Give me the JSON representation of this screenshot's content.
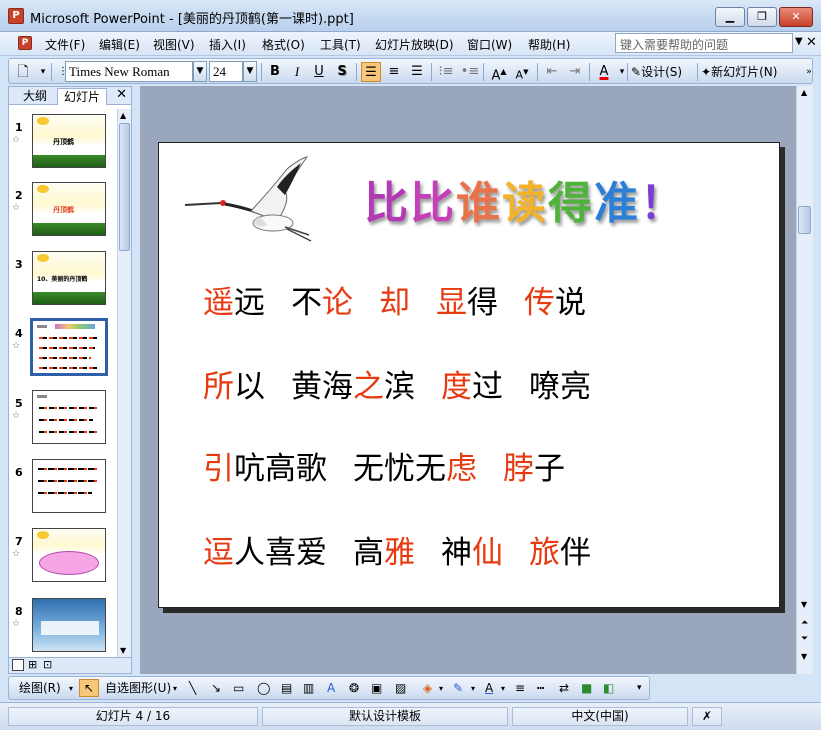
{
  "window": {
    "title": "Microsoft PowerPoint - [美丽的丹顶鹤(第一课时).ppt]",
    "minimize_glyph": "▁",
    "restore_glyph": "❐",
    "close_glyph": "✕"
  },
  "menu": {
    "items": [
      "文件(F)",
      "编辑(E)",
      "视图(V)",
      "插入(I)",
      "格式(O)",
      "工具(T)",
      "幻灯片放映(D)",
      "窗口(W)",
      "帮助(H)"
    ],
    "help_placeholder": "键入需要帮助的问题"
  },
  "toolbar": {
    "font_name": "Times New Roman",
    "font_size": "24",
    "bold": "B",
    "italic": "I",
    "underline": "U",
    "shadow": "S",
    "design_label": "设计(S)",
    "new_slide_label": "新幻灯片(N)"
  },
  "left_pane": {
    "tab_outline": "大纲",
    "tab_slides": "幻灯片",
    "close_glyph": "✕",
    "slides": [
      {
        "num": "1",
        "star": "☆",
        "label": "丹顶鹤"
      },
      {
        "num": "2",
        "star": "☆",
        "label": "丹顶鹤"
      },
      {
        "num": "3",
        "star": "",
        "label": "10、美丽的丹顶鹤"
      },
      {
        "num": "4",
        "star": "☆",
        "label": ""
      },
      {
        "num": "5",
        "star": "☆",
        "label": ""
      },
      {
        "num": "6",
        "star": "",
        "label": ""
      },
      {
        "num": "7",
        "star": "☆",
        "label": ""
      },
      {
        "num": "8",
        "star": "☆",
        "label": ""
      }
    ]
  },
  "slide": {
    "title_chars": [
      "比",
      "比",
      "谁",
      "读",
      "得",
      "准",
      "！"
    ],
    "title_colors": [
      "#b43ab5",
      "#c43fb8",
      "#e8734a",
      "#f2b22a",
      "#4fb23a",
      "#2b7fd6",
      "#7a3fd0"
    ],
    "rows": [
      [
        [
          {
            "t": "遥",
            "c": "red"
          },
          {
            "t": "远",
            "c": "blk"
          }
        ],
        [
          {
            "t": "不",
            "c": "blk"
          },
          {
            "t": "论",
            "c": "red"
          }
        ],
        [
          {
            "t": "却",
            "c": "red"
          }
        ],
        [
          {
            "t": "显",
            "c": "red"
          },
          {
            "t": "得",
            "c": "blk"
          }
        ],
        [
          {
            "t": "传",
            "c": "red"
          },
          {
            "t": "说",
            "c": "blk"
          }
        ]
      ],
      [
        [
          {
            "t": "所",
            "c": "red"
          },
          {
            "t": "以",
            "c": "blk"
          }
        ],
        [
          {
            "t": "黄海",
            "c": "blk"
          },
          {
            "t": "之",
            "c": "red"
          },
          {
            "t": "滨",
            "c": "blk"
          }
        ],
        [
          {
            "t": "度",
            "c": "red"
          },
          {
            "t": "过",
            "c": "blk"
          }
        ],
        [
          {
            "t": "嘹亮",
            "c": "blk"
          }
        ]
      ],
      [
        [
          {
            "t": "引",
            "c": "red"
          },
          {
            "t": "吭高歌",
            "c": "blk"
          }
        ],
        [
          {
            "t": "无忧无",
            "c": "blk"
          },
          {
            "t": "虑",
            "c": "red"
          }
        ],
        [
          {
            "t": "脖",
            "c": "red"
          },
          {
            "t": "子",
            "c": "blk"
          }
        ]
      ],
      [
        [
          {
            "t": "逗",
            "c": "red"
          },
          {
            "t": "人喜爱",
            "c": "blk"
          }
        ],
        [
          {
            "t": "高",
            "c": "blk"
          },
          {
            "t": "雅",
            "c": "red"
          }
        ],
        [
          {
            "t": "神",
            "c": "blk"
          },
          {
            "t": "仙",
            "c": "red"
          }
        ],
        [
          {
            "t": "旅",
            "c": "red"
          },
          {
            "t": "伴",
            "c": "blk"
          }
        ]
      ]
    ]
  },
  "drawbar": {
    "draw_label": "绘图(R)",
    "autoshapes_label": "自选图形(U)"
  },
  "status": {
    "slide_pos": "幻灯片 4 / 16",
    "template": "默认设计模板",
    "language": "中文(中国)"
  },
  "colors": {
    "accent_red": "#e83a10",
    "selection_border": "#2f5fa8",
    "workspace_bg": "#9aa6bb"
  }
}
